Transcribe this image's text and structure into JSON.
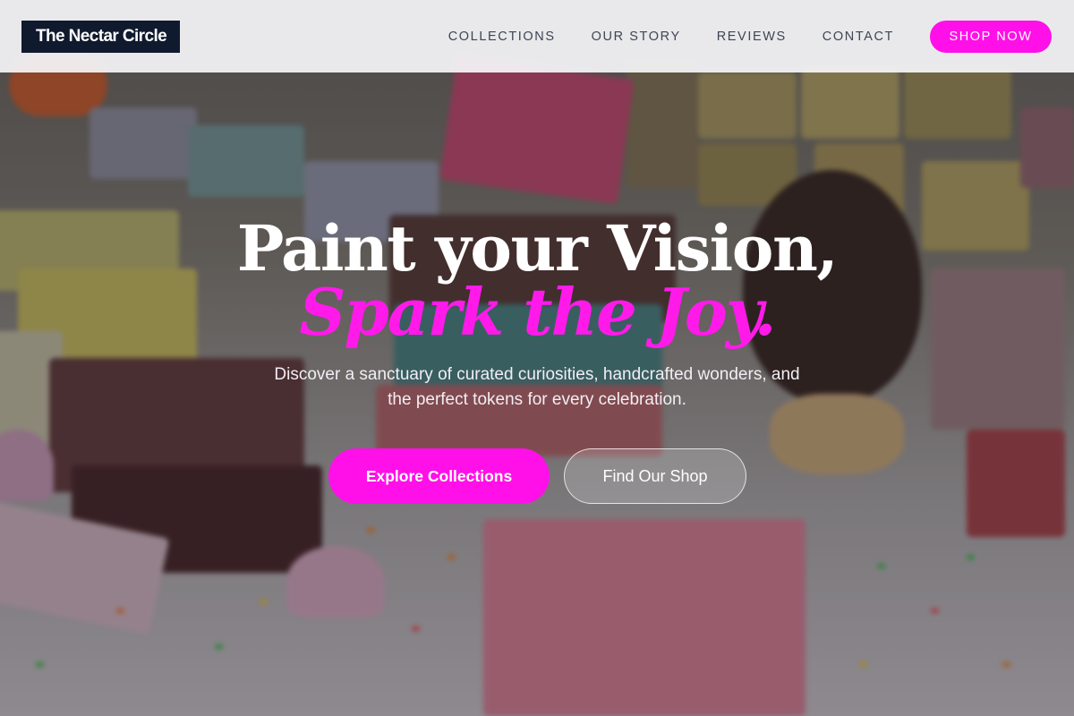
{
  "header": {
    "logo": "The Nectar Circle",
    "nav": [
      {
        "label": "COLLECTIONS"
      },
      {
        "label": "OUR STORY"
      },
      {
        "label": "REVIEWS"
      },
      {
        "label": "CONTACT"
      }
    ],
    "cta": "SHOP NOW"
  },
  "hero": {
    "headline_line1": "Paint your Vision,",
    "headline_line2": "Spark the Joy.",
    "subtitle_line1": "Discover a sanctuary of curated curiosities, handcrafted wonders, and",
    "subtitle_line2": "the perfect tokens for every celebration.",
    "primary_button": "Explore Collections",
    "secondary_button": "Find Our Shop"
  },
  "colors": {
    "accent": "#ff10e8",
    "logo_bg": "#101a2e",
    "nav_text": "#3f4555",
    "header_bg": "#f5f5f7"
  }
}
